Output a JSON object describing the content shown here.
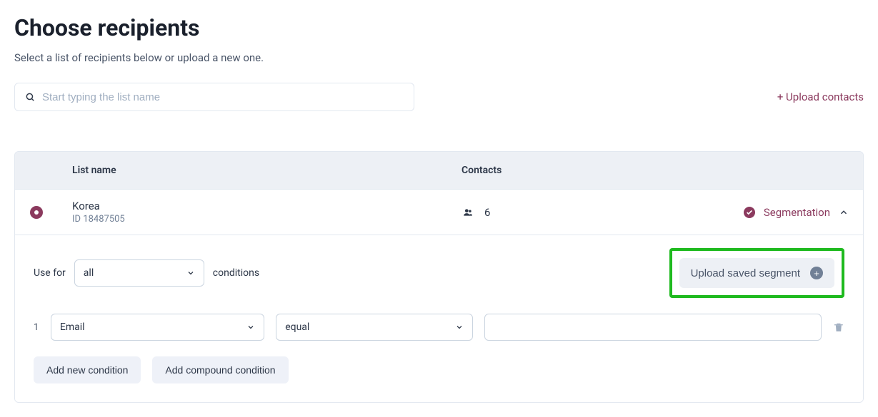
{
  "header": {
    "title": "Choose recipients",
    "subtitle": "Select a list of recipients below or upload a new one."
  },
  "search": {
    "placeholder": "Start typing the list name"
  },
  "upload_contacts_label": "+ Upload contacts",
  "table": {
    "col_name": "List name",
    "col_contacts": "Contacts"
  },
  "row": {
    "name": "Korea",
    "id_label": "ID 18487505",
    "contacts": "6",
    "segmentation_label": "Segmentation"
  },
  "segment": {
    "use_for_label": "Use for",
    "match_mode": "all",
    "conditions_label": "conditions",
    "upload_saved_label": "Upload saved segment",
    "condition_index": "1",
    "field_value": "Email",
    "operator_value": "equal",
    "value_input": "",
    "add_condition_label": "Add new condition",
    "add_compound_label": "Add compound condition"
  }
}
